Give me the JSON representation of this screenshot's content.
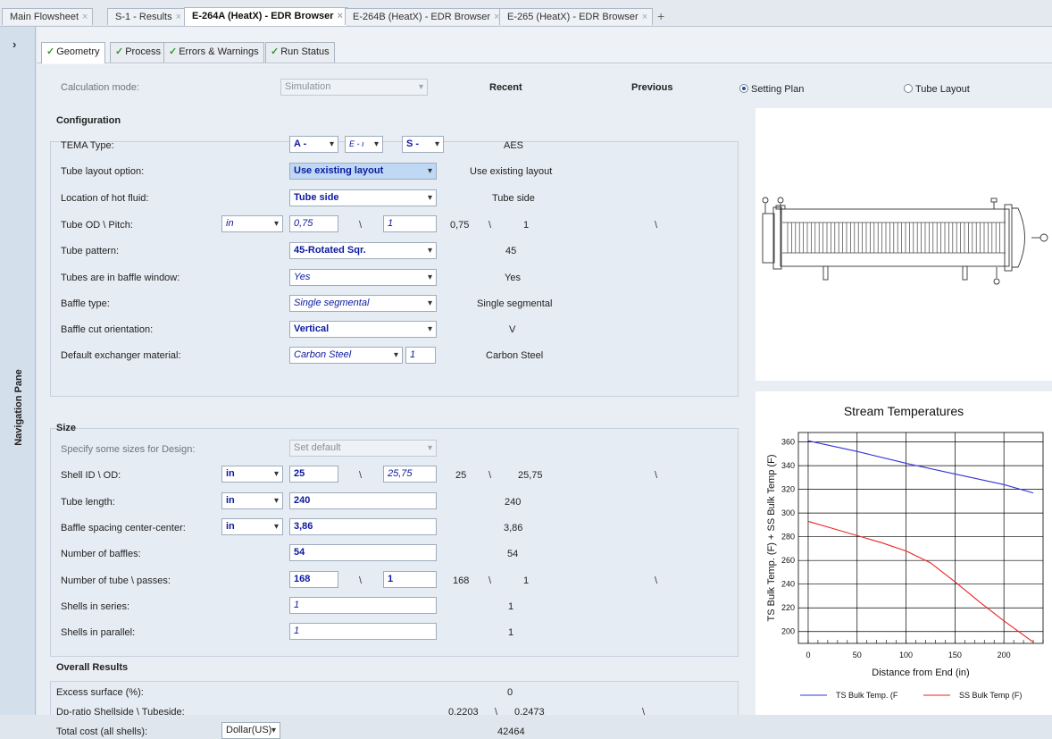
{
  "doc_tabs": [
    "Main Flowsheet",
    "S-1 - Results",
    "E-264A (HeatX) - EDR Browser",
    "E-264B (HeatX) - EDR Browser",
    "E-265 (HeatX) - EDR Browser"
  ],
  "doc_tab_add": "+",
  "doc_tab_close": "×",
  "nav": {
    "label": "Navigation Pane",
    "chevron": "›"
  },
  "sub_tabs": [
    "Geometry",
    "Process",
    "Errors & Warnings",
    "Run Status"
  ],
  "sub_tab_check": "✓",
  "calc": {
    "label": "Calculation mode:",
    "value": "Simulation"
  },
  "columns": {
    "recent": "Recent",
    "previous": "Previous"
  },
  "view": {
    "setting_plan": "Setting Plan",
    "tube_layout": "Tube Layout",
    "selected": "setting_plan"
  },
  "configuration": {
    "title": "Configuration",
    "tema_label": "TEMA Type:",
    "tema_front": "A -",
    "tema_shell": "E - ı",
    "tema_rear": "S -",
    "tema_recent": "AES",
    "layout_label": "Tube layout option:",
    "layout_value": "Use existing layout",
    "layout_recent": "Use existing layout",
    "hot_label": "Location of hot fluid:",
    "hot_value": "Tube side",
    "hot_recent": "Tube side",
    "od_label": "Tube OD \\ Pitch:",
    "od_unit": "in",
    "od_value": "0,75",
    "pitch_value": "1",
    "od_recent": "0,75",
    "pitch_recent": "1",
    "pattern_label": "Tube pattern:",
    "pattern_value": "45-Rotated Sqr.",
    "pattern_recent": "45",
    "window_label": "Tubes are in baffle window:",
    "window_value": "Yes",
    "window_recent": "Yes",
    "baffle_label": "Baffle type:",
    "baffle_value": "Single segmental",
    "baffle_recent": "Single segmental",
    "cut_label": "Baffle cut orientation:",
    "cut_value": "Vertical",
    "cut_recent": "V",
    "material_label": "Default exchanger material:",
    "material_value": "Carbon Steel",
    "material_num": "1",
    "material_recent": "Carbon Steel"
  },
  "size": {
    "title": "Size",
    "specify_label": "Specify some sizes for Design:",
    "specify_value": "Set default",
    "shell_label": "Shell ID \\ OD:",
    "shell_unit": "in",
    "shell_id": "25",
    "shell_od": "25,75",
    "shell_id_recent": "25",
    "shell_od_recent": "25,75",
    "length_label": "Tube length:",
    "length_unit": "in",
    "length_value": "240",
    "length_recent": "240",
    "spacing_label": "Baffle spacing center-center:",
    "spacing_unit": "in",
    "spacing_value": "3,86",
    "spacing_recent": "3,86",
    "nbaffles_label": "Number of baffles:",
    "nbaffles_value": "54",
    "nbaffles_recent": "54",
    "ntubes_label": "Number of tube \\ passes:",
    "ntubes_value": "168",
    "npasses_value": "1",
    "ntubes_recent": "168",
    "npasses_recent": "1",
    "series_label": "Shells in series:",
    "series_value": "1",
    "series_recent": "1",
    "parallel_label": "Shells in parallel:",
    "parallel_value": "1",
    "parallel_recent": "1"
  },
  "overall": {
    "title": "Overall Results",
    "excess_label": "Excess surface (%):",
    "excess_recent": "0",
    "dp_label": "Dp-ratio Shellside \\ Tubeside:",
    "dp_shell": "0,2203",
    "dp_tube": "0,2473",
    "cost_label": "Total cost (all shells):",
    "cost_unit": "Dollar(US)",
    "cost_recent": "42464"
  },
  "backslash": "\\",
  "colors": {
    "ts_line": "#3333dd",
    "ss_line": "#ee2222",
    "field_text": "#0c1aa0",
    "check": "#2e9b2e"
  },
  "chart_data": {
    "type": "line",
    "title": "Stream Temperatures",
    "xlabel": "Distance from End (in)",
    "ylabel": "TS Bulk Temp. (F) + SS Bulk Temp (F)",
    "xlim": [
      -10,
      240
    ],
    "ylim": [
      190,
      368
    ],
    "xticks": [
      0,
      50,
      100,
      150,
      200
    ],
    "yticks": [
      200,
      220,
      240,
      260,
      280,
      300,
      320,
      340,
      360
    ],
    "grid": true,
    "legend_position": "bottom",
    "series": [
      {
        "name": "TS Bulk Temp. (F",
        "color": "#3333dd",
        "x": [
          0,
          50,
          100,
          150,
          200,
          230
        ],
        "y": [
          361,
          352,
          342,
          333,
          324,
          317
        ]
      },
      {
        "name": "SS Bulk Temp (F)",
        "color": "#ee2222",
        "x": [
          0,
          25,
          50,
          75,
          100,
          125,
          150,
          175,
          200,
          230
        ],
        "y": [
          293,
          287,
          281,
          275,
          268,
          258,
          242,
          225,
          209,
          191
        ]
      }
    ]
  }
}
